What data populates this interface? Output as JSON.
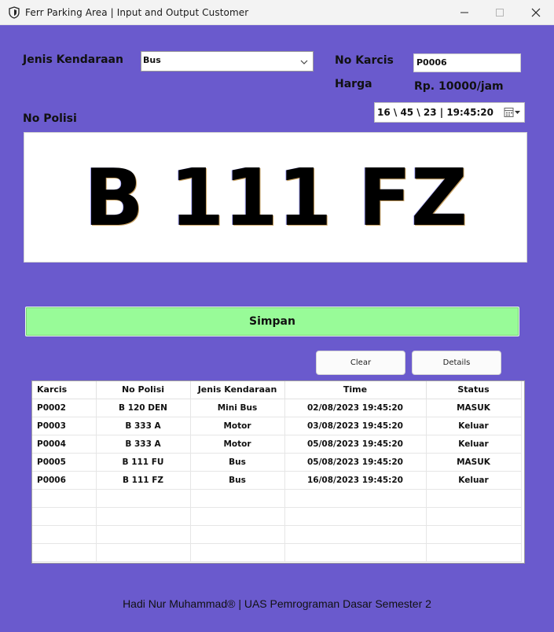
{
  "window": {
    "title": "Ferr Parking Area | Input and Output Customer"
  },
  "form": {
    "jenis_label": "Jenis Kendaraan",
    "jenis_value": "Bus",
    "no_karcis_label": "No Karcis",
    "no_karcis_value": "P0006",
    "harga_label": "Harga",
    "harga_value": "Rp. 10000/jam",
    "date_value": "16 \\ 45 \\ 23 | 19:45:20",
    "no_polisi_label": "No Polisi",
    "plate_value": "B 111 FZ"
  },
  "buttons": {
    "simpan": "Simpan",
    "clear": "Clear",
    "details": "Details"
  },
  "table": {
    "columns": [
      "Karcis",
      "No Polisi",
      "Jenis Kendaraan",
      "Time",
      "Status"
    ],
    "rows": [
      [
        "P0002",
        "B 120 DEN",
        "Mini Bus",
        "02/08/2023 19:45:20",
        "MASUK"
      ],
      [
        "P0003",
        "B 333 A",
        "Motor",
        "03/08/2023 19:45:20",
        "Keluar"
      ],
      [
        "P0004",
        "B 333 A",
        "Motor",
        "05/08/2023 19:45:20",
        "Keluar"
      ],
      [
        "P0005",
        "B 111 FU",
        "Bus",
        "05/08/2023 19:45:20",
        "MASUK"
      ],
      [
        "P0006",
        "B 111 FZ",
        "Bus",
        "16/08/2023 19:45:20",
        "Keluar"
      ]
    ],
    "empty_rows": 4
  },
  "footer": {
    "text": "Hadi Nur Muhammad® | UAS Pemrograman Dasar Semester 2"
  },
  "colors": {
    "background": "#6a5acd",
    "save_button": "#98fb98"
  },
  "icons": {
    "app": "shield-icon",
    "combo": "chevron-down-icon",
    "date": "calendar-icon"
  }
}
